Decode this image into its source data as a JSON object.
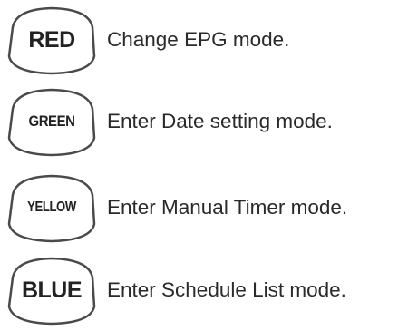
{
  "items": [
    {
      "button": "RED",
      "description": "Change EPG mode."
    },
    {
      "button": "GREEN",
      "description": "Enter Date setting mode."
    },
    {
      "button": "YELLOW",
      "description": "Enter Manual Timer mode."
    },
    {
      "button": "BLUE",
      "description": "Enter Schedule List mode."
    }
  ]
}
